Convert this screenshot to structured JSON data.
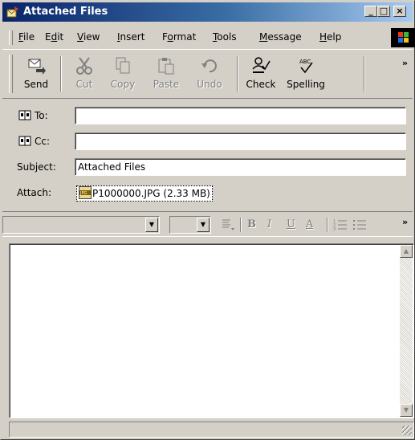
{
  "window": {
    "title": "Attached Files"
  },
  "title_buttons": {
    "minimize": "_",
    "maximize": "□",
    "close": "×"
  },
  "menu": {
    "items": [
      {
        "accel": "F",
        "rest": "ile"
      },
      {
        "pre": "E",
        "accel": "d",
        "rest": "it"
      },
      {
        "accel": "V",
        "rest": "iew"
      },
      {
        "accel": "I",
        "rest": "nsert"
      },
      {
        "pre": "F",
        "accel": "o",
        "rest": "rmat"
      },
      {
        "accel": "T",
        "rest": "ools"
      },
      {
        "accel": "M",
        "rest": "essage"
      },
      {
        "accel": "H",
        "rest": "elp"
      }
    ]
  },
  "toolbar": {
    "send": "Send",
    "cut": "Cut",
    "copy": "Copy",
    "paste": "Paste",
    "undo": "Undo",
    "check": "Check",
    "spelling": "Spelling",
    "more": "»"
  },
  "fields": {
    "to_label": "To:",
    "to_value": "",
    "cc_label": "Cc:",
    "cc_value": "",
    "subject_label": "Subject:",
    "subject_value": "Attached Files",
    "attach_label": "Attach:",
    "attachment": "P1000000.JPG (2.33 MB)",
    "attachment_icon_text": "JPG"
  },
  "format_bar": {
    "font": "",
    "size": "",
    "bold": "B",
    "italic": "I",
    "underline": "U",
    "color": "A",
    "more": "»"
  },
  "colors": {
    "title_start": "#0a246a",
    "title_end": "#a6caf0",
    "face": "#d4d0c8"
  }
}
